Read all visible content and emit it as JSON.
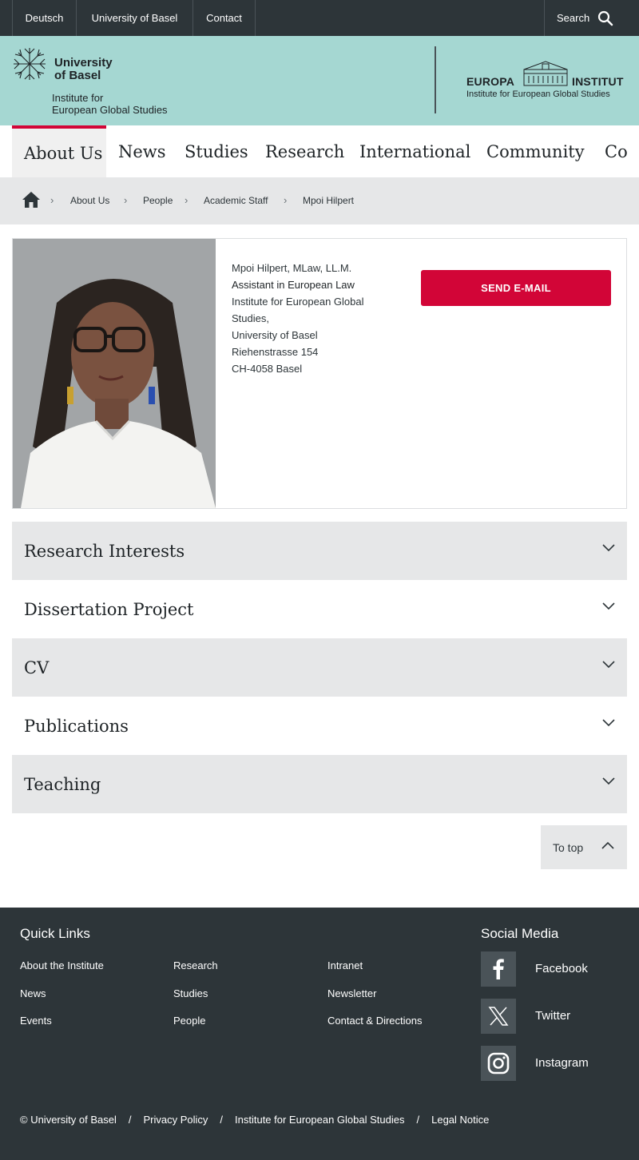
{
  "topbar": {
    "links": [
      "Deutsch",
      "University of Basel",
      "Contact"
    ],
    "search_label": "Search"
  },
  "header": {
    "university_line1": "University",
    "university_line2": "of Basel",
    "institute_line1": "Institute for",
    "institute_line2": "European Global Studies",
    "partner_word1": "EUROPA",
    "partner_word2": "INSTITUT",
    "partner_subtitle": "Institute for European Global Studies"
  },
  "mainnav": {
    "items": [
      "About Us",
      "News",
      "Studies",
      "Research",
      "International",
      "Community",
      "Co"
    ],
    "active": "About Us"
  },
  "breadcrumb": {
    "items": [
      "About Us",
      "People",
      "Academic Staff",
      "Mpoi Hilpert"
    ]
  },
  "profile": {
    "name": "Mpoi Hilpert, MLaw, LL.M.",
    "role": "Assistant in European Law",
    "address": [
      "Institute for European Global",
      "Studies,",
      "University of Basel",
      "Riehenstrasse 154",
      "CH-4058 Basel"
    ],
    "email_button": "SEND E-MAIL"
  },
  "accordion": {
    "items": [
      "Research Interests",
      "Dissertation Project",
      "CV",
      "Publications",
      "Teaching"
    ]
  },
  "to_top": "To top",
  "footer": {
    "quick_links_title": "Quick Links",
    "quick_links": [
      "About the Institute",
      "Research",
      "Intranet",
      "News",
      "Studies",
      "Newsletter",
      "Events",
      "People",
      "Contact & Directions"
    ],
    "social_title": "Social Media",
    "social": [
      "Facebook",
      "Twitter",
      "Instagram"
    ],
    "bottom": [
      "© University of Basel",
      "Privacy Policy",
      "Institute for European Global Studies",
      "Legal Notice"
    ],
    "separator": "/"
  },
  "colors": {
    "topbar": "#2d3539",
    "header": "#a5d7d2",
    "accent_red": "#d20537",
    "light_gray": "#e6e7e8",
    "footer": "#2d3539"
  }
}
